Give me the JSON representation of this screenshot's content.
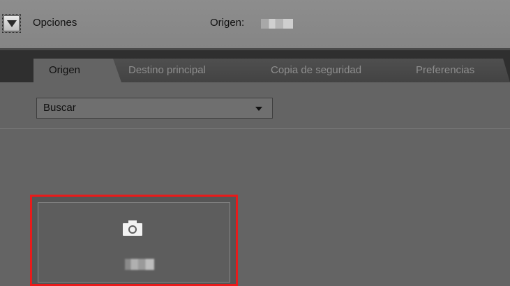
{
  "options": {
    "label": "Opciones",
    "toggle_icon": "triangle-down-icon",
    "source_label": "Origen:",
    "source_value_obscured": true
  },
  "tabs": [
    {
      "label": "Origen",
      "active": true
    },
    {
      "label": "Destino principal",
      "active": false
    },
    {
      "label": "Copia de seguridad",
      "active": false
    },
    {
      "label": "Preferencias",
      "active": false
    }
  ],
  "search_select": {
    "value": "Buscar"
  },
  "device": {
    "icon": "camera-icon",
    "name_obscured": true,
    "selected": true,
    "highlight_color": "#e81b1b"
  }
}
